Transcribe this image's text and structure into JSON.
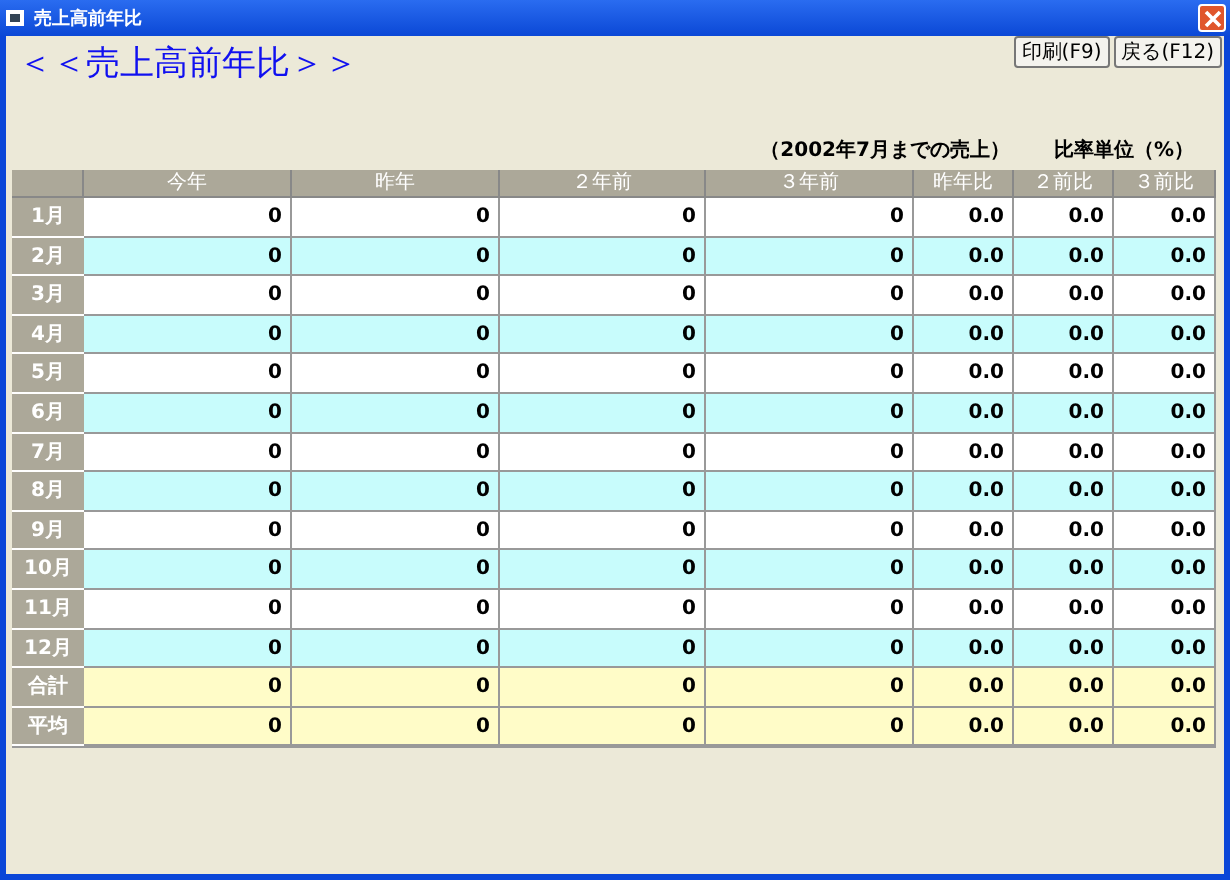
{
  "window": {
    "title": "売上高前年比"
  },
  "heading": "＜＜売上高前年比＞＞",
  "buttons": [
    "印刷(F9)",
    "戻る(F12)"
  ],
  "period_note": "（2002年7月までの売上）",
  "unit_note": "比率単位（%）",
  "table": {
    "columns": [
      "今年",
      "昨年",
      "２年前",
      "３年前",
      "昨年比",
      "２前比",
      "３前比"
    ],
    "rows": [
      {
        "kind": "month",
        "label": "1月",
        "cells": [
          "0",
          "0",
          "0",
          "0",
          "0.0",
          "0.0",
          "0.0"
        ]
      },
      {
        "kind": "month",
        "label": "2月",
        "cells": [
          "0",
          "0",
          "0",
          "0",
          "0.0",
          "0.0",
          "0.0"
        ]
      },
      {
        "kind": "month",
        "label": "3月",
        "cells": [
          "0",
          "0",
          "0",
          "0",
          "0.0",
          "0.0",
          "0.0"
        ]
      },
      {
        "kind": "month",
        "label": "4月",
        "cells": [
          "0",
          "0",
          "0",
          "0",
          "0.0",
          "0.0",
          "0.0"
        ]
      },
      {
        "kind": "month",
        "label": "5月",
        "cells": [
          "0",
          "0",
          "0",
          "0",
          "0.0",
          "0.0",
          "0.0"
        ]
      },
      {
        "kind": "month",
        "label": "6月",
        "cells": [
          "0",
          "0",
          "0",
          "0",
          "0.0",
          "0.0",
          "0.0"
        ]
      },
      {
        "kind": "month",
        "label": "7月",
        "cells": [
          "0",
          "0",
          "0",
          "0",
          "0.0",
          "0.0",
          "0.0"
        ]
      },
      {
        "kind": "month",
        "label": "8月",
        "cells": [
          "0",
          "0",
          "0",
          "0",
          "0.0",
          "0.0",
          "0.0"
        ]
      },
      {
        "kind": "month",
        "label": "9月",
        "cells": [
          "0",
          "0",
          "0",
          "0",
          "0.0",
          "0.0",
          "0.0"
        ]
      },
      {
        "kind": "month",
        "label": "10月",
        "cells": [
          "0",
          "0",
          "0",
          "0",
          "0.0",
          "0.0",
          "0.0"
        ]
      },
      {
        "kind": "month",
        "label": "11月",
        "cells": [
          "0",
          "0",
          "0",
          "0",
          "0.0",
          "0.0",
          "0.0"
        ]
      },
      {
        "kind": "month",
        "label": "12月",
        "cells": [
          "0",
          "0",
          "0",
          "0",
          "0.0",
          "0.0",
          "0.0"
        ]
      },
      {
        "kind": "summary",
        "label": "合計",
        "cells": [
          "0",
          "0",
          "0",
          "0",
          "0.0",
          "0.0",
          "0.0"
        ]
      },
      {
        "kind": "summary",
        "label": "平均",
        "cells": [
          "0",
          "0",
          "0",
          "0",
          "0.0",
          "0.0",
          "0.0"
        ]
      }
    ]
  }
}
